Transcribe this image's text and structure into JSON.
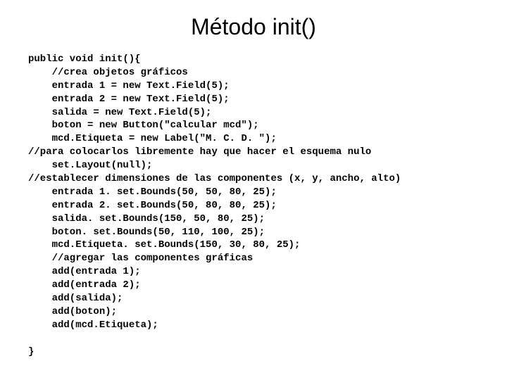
{
  "title": "Método init()",
  "code": {
    "l1": "public void init(){",
    "l2": "    //crea objetos gráficos",
    "l3": "    entrada 1 = new Text.Field(5);",
    "l4": "    entrada 2 = new Text.Field(5);",
    "l5": "    salida = new Text.Field(5);",
    "l6": "    boton = new Button(\"calcular mcd\");",
    "l7": "    mcd.Etiqueta = new Label(\"M. C. D. \");",
    "l8": "//para colocarlos libremente hay que hacer el esquema nulo",
    "l9": "    set.Layout(null);",
    "l10": "//establecer dimensiones de las componentes (x, y, ancho, alto)",
    "l11": "    entrada 1. set.Bounds(50, 50, 80, 25);",
    "l12": "    entrada 2. set.Bounds(50, 80, 80, 25);",
    "l13": "    salida. set.Bounds(150, 50, 80, 25);",
    "l14": "    boton. set.Bounds(50, 110, 100, 25);",
    "l15": "    mcd.Etiqueta. set.Bounds(150, 30, 80, 25);",
    "l16": "    //agregar las componentes gráficas",
    "l17": "    add(entrada 1);",
    "l18": "    add(entrada 2);",
    "l19": "    add(salida);",
    "l20": "    add(boton);",
    "l21": "    add(mcd.Etiqueta);",
    "l22": "",
    "l23": "}"
  }
}
